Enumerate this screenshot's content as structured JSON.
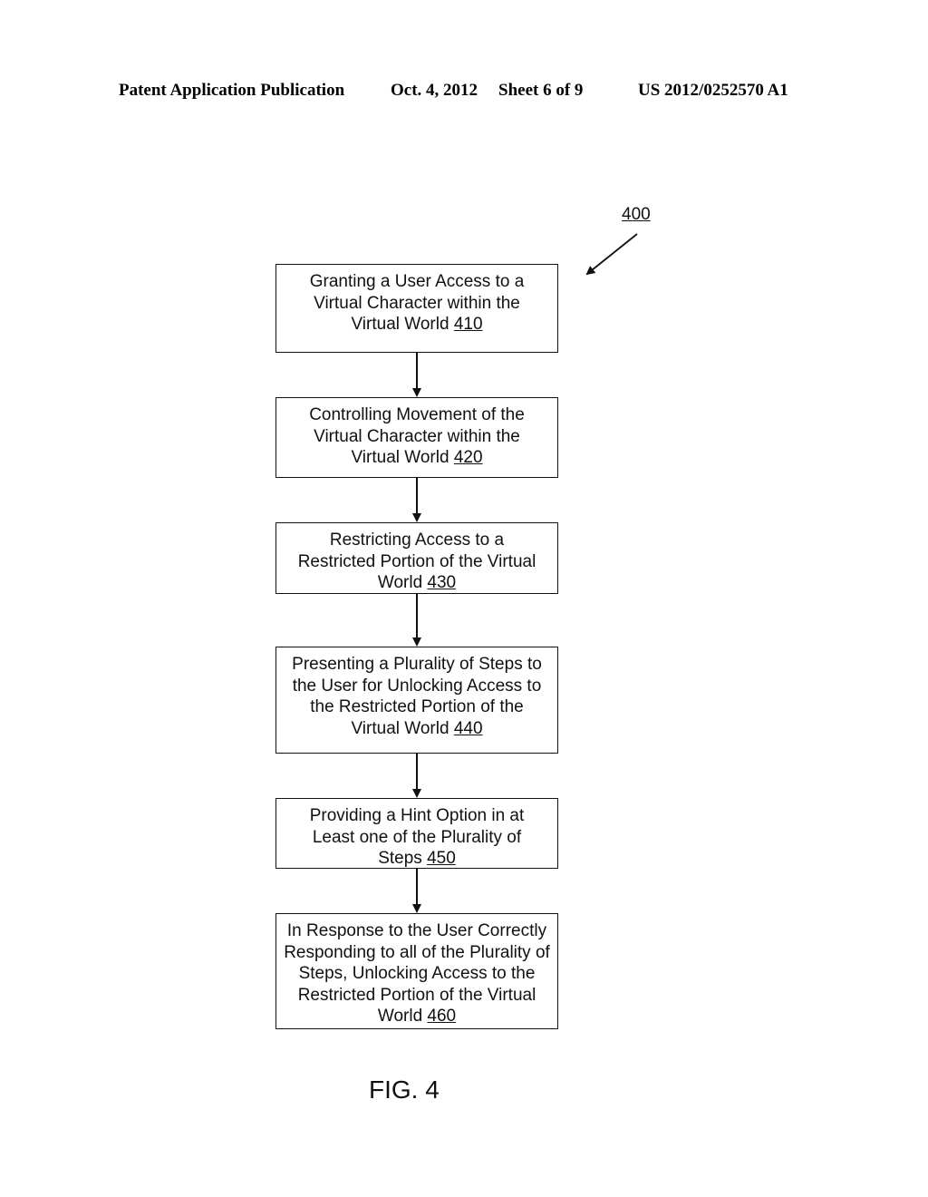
{
  "header": {
    "publication": "Patent Application Publication",
    "date": "Oct. 4, 2012",
    "sheet": "Sheet 6 of 9",
    "number": "US 2012/0252570 A1"
  },
  "diagram": {
    "reference": "400",
    "figure_label": "FIG. 4",
    "steps": [
      {
        "text": "Granting a User Access to a Virtual Character within the Virtual World ",
        "ref": "410"
      },
      {
        "text": "Controlling Movement of the Virtual Character within the Virtual World ",
        "ref": "420"
      },
      {
        "text": "Restricting Access to a Restricted Portion of the Virtual World ",
        "ref": "430"
      },
      {
        "text": "Presenting a Plurality of Steps to the User for Unlocking Access to the Restricted Portion of the Virtual World  ",
        "ref": "440"
      },
      {
        "text": "Providing a Hint Option in at Least one of the Plurality of Steps ",
        "ref": "450"
      },
      {
        "text": "In Response to the User Correctly Responding to all of the Plurality of Steps, Unlocking Access to the Restricted Portion of the Virtual World ",
        "ref": "460"
      }
    ]
  }
}
